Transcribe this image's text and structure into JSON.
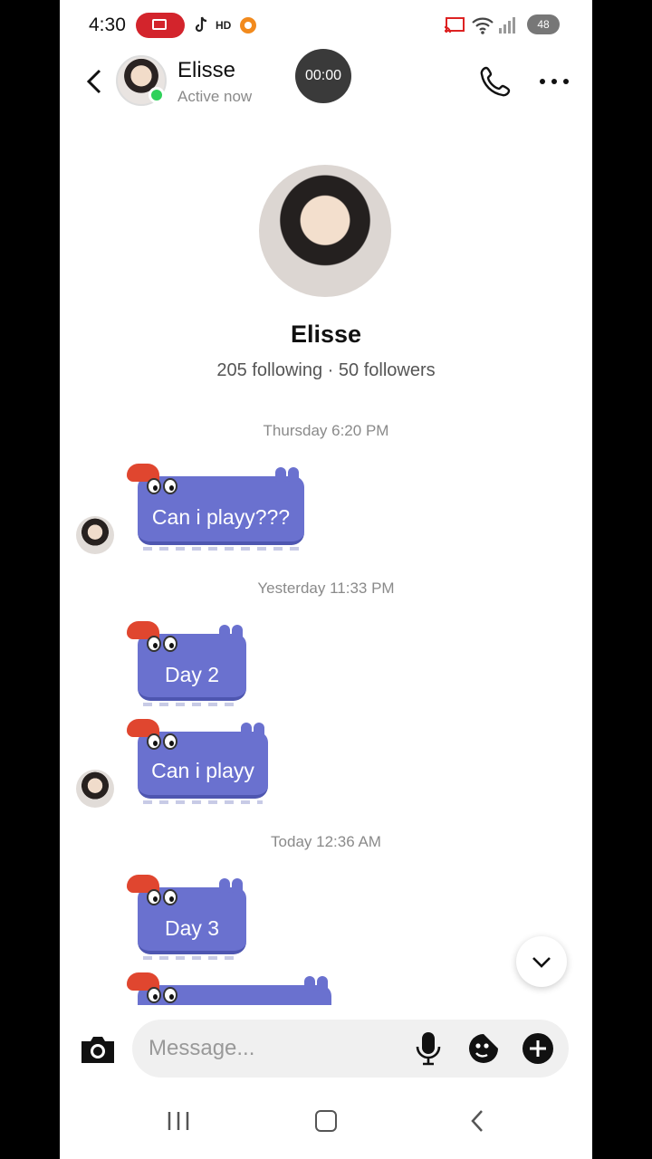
{
  "status_bar": {
    "time": "4:30",
    "battery": "48"
  },
  "header": {
    "name": "Elisse",
    "status": "Active now",
    "call_timer": "00:00"
  },
  "profile": {
    "name": "Elisse",
    "stats": "205 following · 50 followers"
  },
  "timestamps": [
    "Thursday 6:20 PM",
    "Yesterday 11:33 PM",
    "Today 12:36 AM"
  ],
  "messages": [
    {
      "text": "Can i playy???"
    },
    {
      "text": "Day 2"
    },
    {
      "text": "Can i playy"
    },
    {
      "text": "Day 3"
    }
  ],
  "composer": {
    "placeholder": "Message..."
  },
  "colors": {
    "sticker_blue": "#6a71cf",
    "online_green": "#2fd15a",
    "cap_red": "#e0462f"
  }
}
